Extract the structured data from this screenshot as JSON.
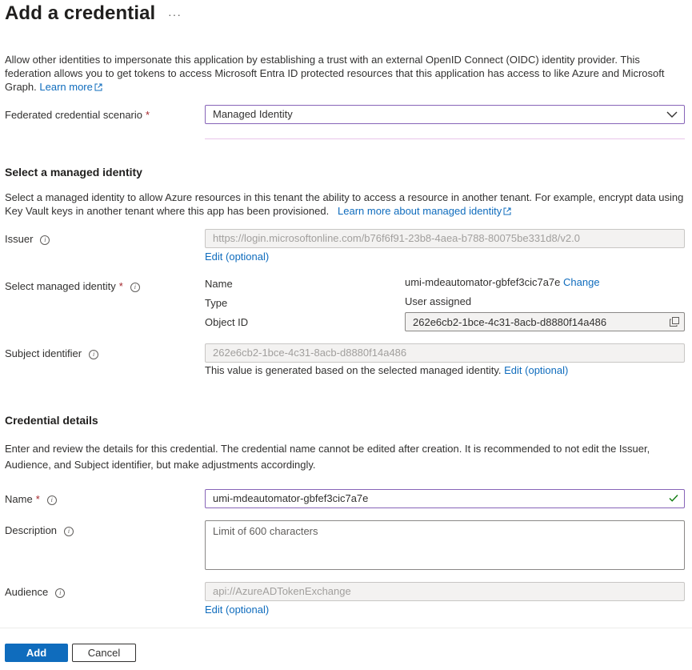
{
  "header": {
    "title": "Add a credential",
    "more": "···"
  },
  "intro": {
    "text": "Allow other identities to impersonate this application by establishing a trust with an external OpenID Connect (OIDC) identity provider. This federation allows you to get tokens to access Microsoft Entra ID protected resources that this application has access to like Azure and Microsoft Graph.",
    "learn_more": "Learn more"
  },
  "scenario": {
    "label": "Federated credential scenario",
    "required": "*",
    "value": "Managed Identity"
  },
  "managed": {
    "heading": "Select a managed identity",
    "text": "Select a managed identity to allow Azure resources in this tenant the ability to access a resource in another tenant. For example, encrypt data using Key Vault keys in another tenant where this app has been provisioned.",
    "learn_more": "Learn more about managed identity",
    "issuer_label": "Issuer",
    "issuer_value": "https://login.microsoftonline.com/b76f6f91-23b8-4aea-b788-80075be331d8/v2.0",
    "issuer_edit": "Edit (optional)",
    "select_label": "Select managed identity",
    "required": "*",
    "name_key": "Name",
    "name_value": "umi-mdeautomator-gbfef3cic7a7e",
    "change": "Change",
    "type_key": "Type",
    "type_value": "User assigned",
    "objectid_key": "Object ID",
    "objectid_value": "262e6cb2-1bce-4c31-8acb-d8880f14a486",
    "subject_label": "Subject identifier",
    "subject_value": "262e6cb2-1bce-4c31-8acb-d8880f14a486",
    "subject_note": "This value is generated based on the selected managed identity.",
    "subject_edit": "Edit (optional)"
  },
  "details": {
    "heading": "Credential details",
    "text": "Enter and review the details for this credential. The credential name cannot be edited after creation. It is recommended to not edit the Issuer, Audience, and Subject identifier, but make adjustments accordingly.",
    "name_label": "Name",
    "required": "*",
    "name_value": "umi-mdeautomator-gbfef3cic7a7e",
    "description_label": "Description",
    "description_placeholder": "Limit of 600 characters",
    "audience_label": "Audience",
    "audience_value": "api://AzureADTokenExchange",
    "audience_edit": "Edit (optional)"
  },
  "footer": {
    "add": "Add",
    "cancel": "Cancel"
  },
  "colors": {
    "link": "#0f6cbd",
    "primary": "#0f6cbd",
    "required": "#a4262c",
    "focus": "#8764b8",
    "valid": "#107c10"
  }
}
